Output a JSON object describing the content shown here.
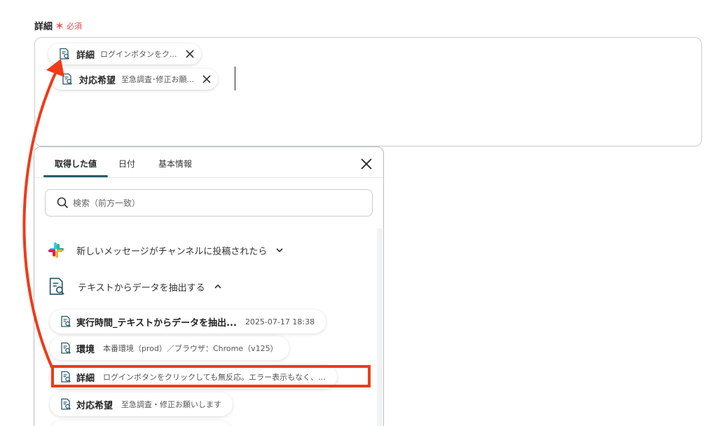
{
  "field": {
    "label": "詳細",
    "required_mark": "＊",
    "required_text": "必須"
  },
  "input": {
    "pills": [
      {
        "name": "詳細",
        "value": "ログインボタンをク..."
      },
      {
        "name": "対応希望",
        "value": "至急調査･修正お願..."
      }
    ]
  },
  "dropdown": {
    "tabs": [
      {
        "label": "取得した値"
      },
      {
        "label": "日付"
      },
      {
        "label": "基本情報"
      }
    ],
    "search_placeholder": "検索（前方一致）",
    "sections": [
      {
        "title": "新しいメッセージがチャンネルに投稿されたら",
        "icon": "slack-icon",
        "expanded": false
      },
      {
        "title": "テキストからデータを抽出する",
        "icon": "document-search-icon",
        "expanded": true
      }
    ],
    "items": [
      {
        "name": "実行時間_テキストからデータを抽出...",
        "value": "2025-07-17 18:38"
      },
      {
        "name": "環境",
        "value": "本番環境（prod）／ブラウザ：Chrome（v125）"
      },
      {
        "name": "詳細",
        "value": "ログインボタンをクリックしても無反応。エラー表示もなく、..."
      },
      {
        "name": "対応希望",
        "value": "至急調査・修正お願いします"
      }
    ]
  },
  "colors": {
    "accent": "#2a5b6e",
    "annotation": "#ee3b18",
    "required": "#e5484d"
  }
}
